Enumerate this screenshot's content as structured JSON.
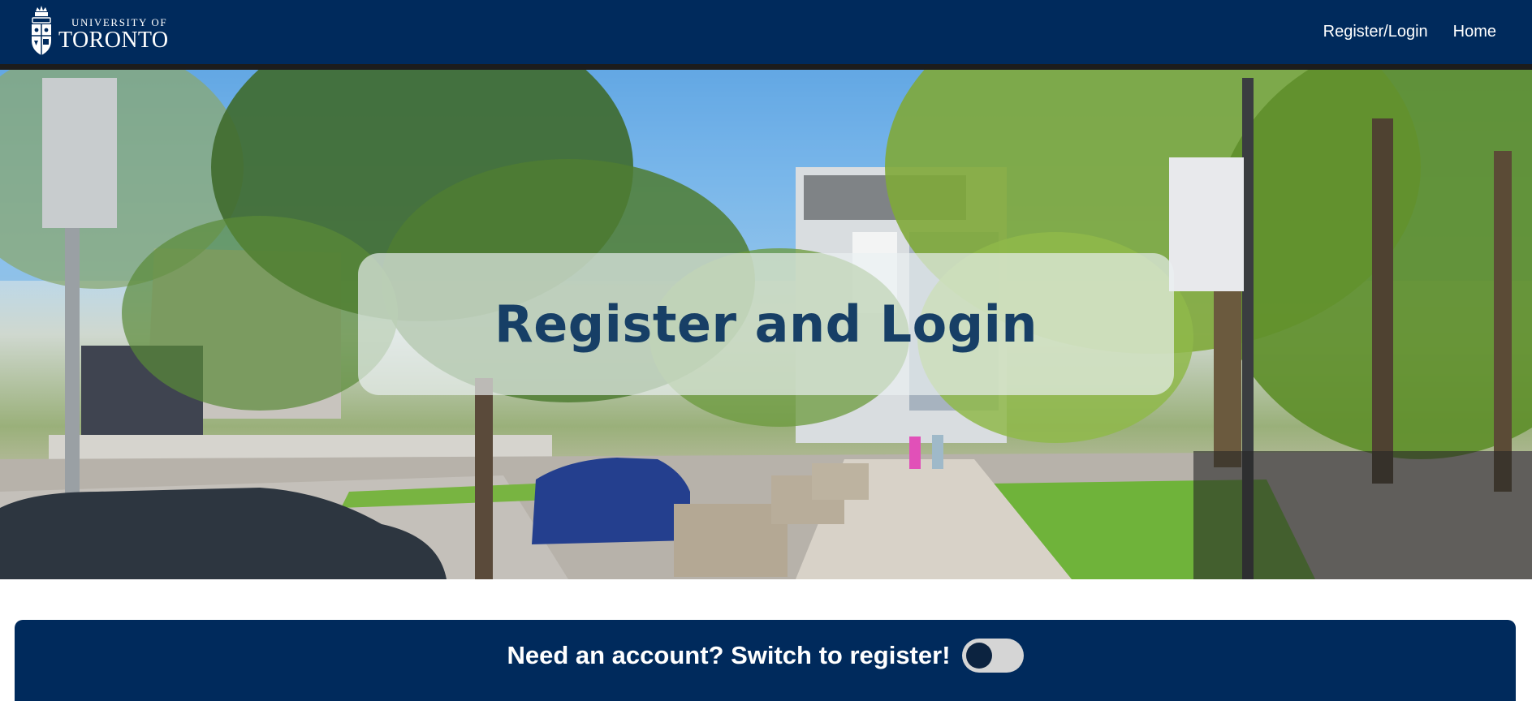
{
  "header": {
    "logo": {
      "line1": "UNIVERSITY OF",
      "line2": "TORONTO",
      "icon": "university-crest-icon"
    },
    "nav": [
      {
        "label": "Register/Login"
      },
      {
        "label": "Home"
      }
    ],
    "background_color": "#002a5c"
  },
  "hero": {
    "title": "Register and Login",
    "image": "campus-photo"
  },
  "switch_panel": {
    "label": "Need an account? Switch to register!",
    "toggle": {
      "checked": false
    }
  },
  "colors": {
    "brand_navy": "#002a5c",
    "title_blue": "#173f66",
    "toggle_track": "#d5d5d5"
  }
}
